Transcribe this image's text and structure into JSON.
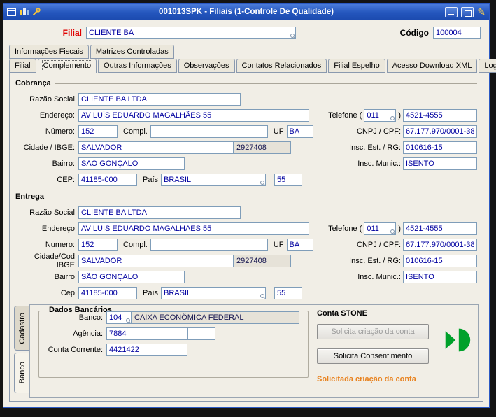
{
  "window": {
    "title": "001013SPK - Filiais (1-Controle De Qualidade)"
  },
  "header": {
    "filial_label": "Filial",
    "filial_value": "CLIENTE BA",
    "codigo_label": "Código",
    "codigo_value": "100004"
  },
  "tabs": {
    "row1": [
      "Informações Fiscais",
      "Matrizes Controladas"
    ],
    "row2": [
      "Filial",
      "Complemento",
      "Outras Informações",
      "Observações",
      "Contatos Relacionados",
      "Filial Espelho",
      "Acesso Download XML",
      "Log"
    ],
    "active": "Complemento"
  },
  "cobranca": {
    "title": "Cobrança",
    "labels": {
      "razao": "Razão Social",
      "endereco": "Endereço:",
      "numero": "Número:",
      "compl": "Compl.",
      "uf": "UF",
      "cidade": "Cidade / IBGE:",
      "bairro": "Bairro:",
      "cep": "CEP:",
      "pais": "País",
      "telefone": "Telefone",
      "paren_open": "(",
      "paren_close": ")",
      "cnpj": "CNPJ / CPF:",
      "ie": "Insc. Est. / RG:",
      "im": "Insc. Munic.:"
    },
    "values": {
      "razao": "CLIENTE BA LTDA",
      "endereco": "AV LUÍS EDUARDO MAGALHÃES 55",
      "numero": "152",
      "compl": "",
      "uf": "BA",
      "cidade": "SALVADOR",
      "ibge": "2927408",
      "bairro": "SÃO GONÇALO",
      "cep": "41185-000",
      "pais": "BRASIL",
      "pais_cod": "55",
      "ddd": "011",
      "telefone": "4521-4555",
      "cnpj": "67.177.970/0001-38",
      "ie": "010616-15",
      "im": "ISENTO"
    }
  },
  "entrega": {
    "title": "Entrega",
    "labels": {
      "razao": "Razão Social",
      "endereco": "Endereço",
      "numero": "Numero:",
      "compl": "Compl.",
      "uf": "UF",
      "cidade": "Cidade/Cod IBGE",
      "bairro": "Bairro",
      "cep": "Cep",
      "pais": "País",
      "telefone": "Telefone",
      "paren_open": "(",
      "paren_close": ")",
      "cnpj": "CNPJ / CPF:",
      "ie": "Insc. Est. / RG:",
      "im": "Insc. Munic.:"
    },
    "values": {
      "razao": "CLIENTE BA LTDA",
      "endereco": "AV LUÍS EDUARDO MAGALHÃES 55",
      "numero": "152",
      "compl": "",
      "uf": "BA",
      "cidade": "SALVADOR",
      "ibge": "2927408",
      "bairro": "SÃO GONÇALO",
      "cep": "41185-000",
      "pais": "BRASIL",
      "pais_cod": "55",
      "ddd": "011",
      "telefone": "4521-4555",
      "cnpj": "67.177.970/0001-38",
      "ie": "010616-15",
      "im": "ISENTO"
    }
  },
  "bancario": {
    "title": "Dados Bancários",
    "banco_label": "Banco:",
    "banco_cod": "104",
    "banco_nome": "CAIXA ECONÔMICA FEDERAL",
    "agencia_label": "Agência:",
    "agencia": "7884",
    "agencia_extra": "",
    "conta_label": "Conta Corrente:",
    "conta": "4421422"
  },
  "stone": {
    "title": "Conta STONE",
    "btn_criacao": "Solicita criação da conta",
    "btn_consentimento": "Solicita Consentimento",
    "status": "Solicitada criação da conta"
  },
  "side_tabs": [
    "Cadastro",
    "Banco"
  ],
  "colors": {
    "titlebar": "#2456BD",
    "field_text": "#0000A0",
    "filial_label": "#E00000",
    "status_orange": "#E8821E",
    "stone_green": "#00A12B",
    "readonly_bg": "#E6E2D8"
  }
}
